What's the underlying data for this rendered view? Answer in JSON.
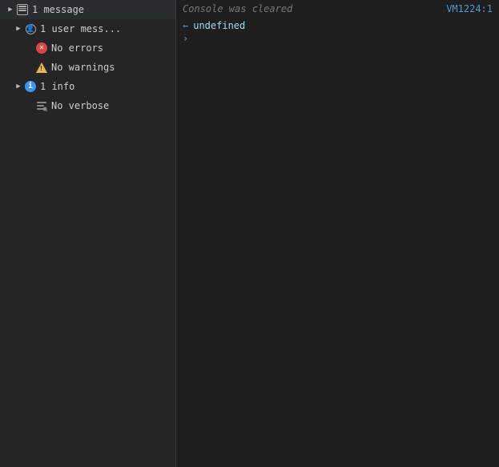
{
  "sidebar": {
    "items": [
      {
        "id": "messages",
        "label": "1 message",
        "hasChevron": true,
        "expanded": false,
        "icon": "message-icon",
        "indent": 0
      },
      {
        "id": "user-messages",
        "label": "1 user mess...",
        "hasChevron": true,
        "expanded": false,
        "icon": "user-icon",
        "indent": 1
      },
      {
        "id": "errors",
        "label": "No errors",
        "hasChevron": false,
        "icon": "error-icon",
        "indent": 1
      },
      {
        "id": "warnings",
        "label": "No warnings",
        "hasChevron": false,
        "icon": "warning-icon",
        "indent": 1
      },
      {
        "id": "info",
        "label": "1 info",
        "hasChevron": true,
        "expanded": false,
        "icon": "info-icon",
        "indent": 1
      },
      {
        "id": "verbose",
        "label": "No verbose",
        "hasChevron": false,
        "icon": "verbose-icon",
        "indent": 1
      }
    ]
  },
  "console": {
    "cleared_text": "Console was cleared",
    "cleared_italic_word": "was",
    "file_ref": "VM1224:1",
    "output_value": "undefined",
    "output_arrow": "←"
  }
}
